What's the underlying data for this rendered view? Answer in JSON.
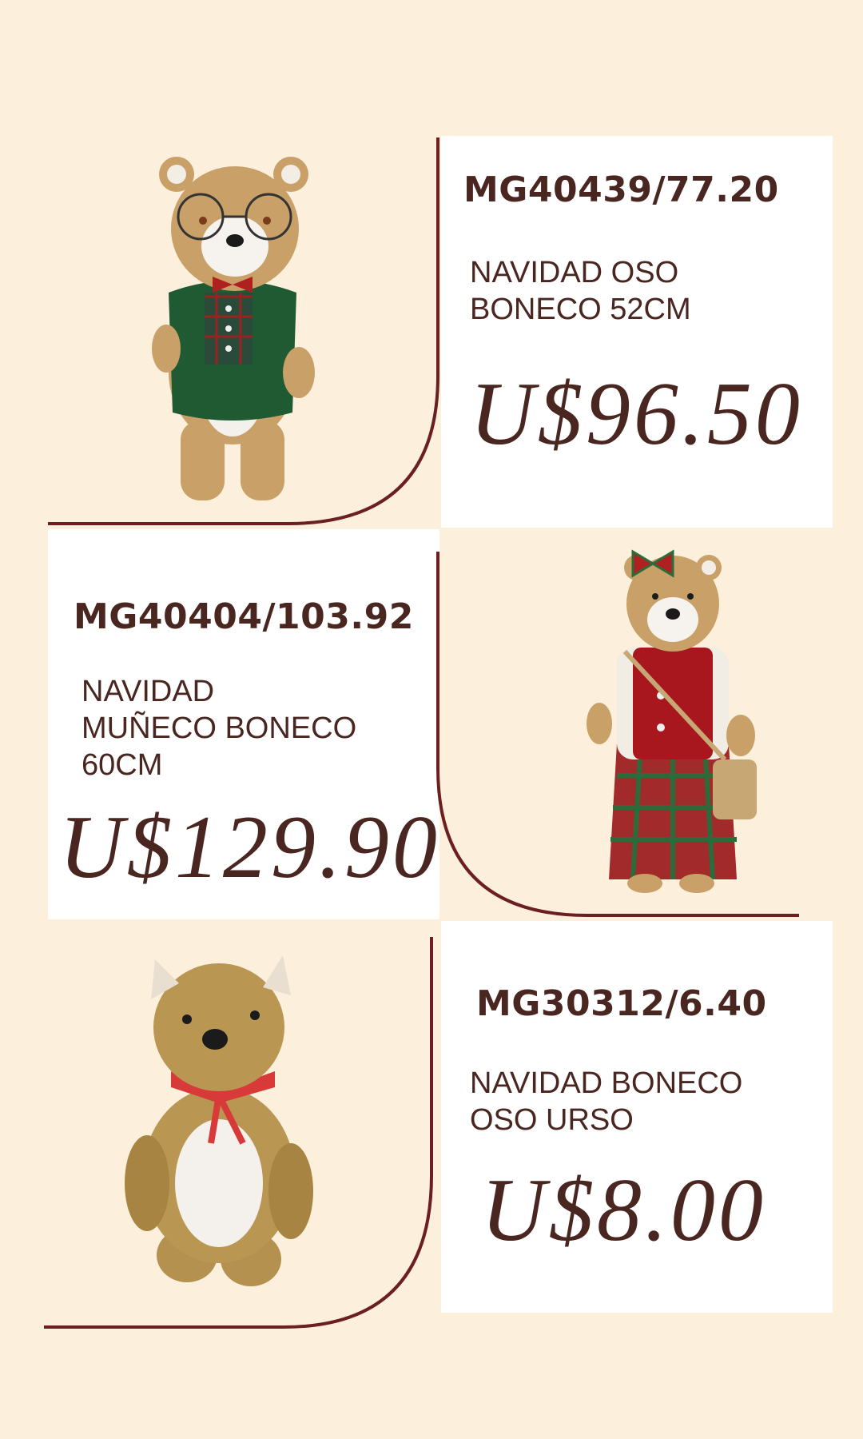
{
  "products": [
    {
      "code": "MG40439/77.20",
      "description": "NAVIDAD OSO\nBONECO 52CM",
      "price": "U$96.50",
      "image": "bear-with-glasses-green-sweater"
    },
    {
      "code": "MG40404/103.92",
      "description": "NAVIDAD\nMUÑECO BONECO\n60CM",
      "price": "U$129.90",
      "image": "bear-girl-red-vest-plaid-skirt"
    },
    {
      "code": "MG30312/6.40",
      "description": "NAVIDAD BONECO\nOSO URSO",
      "price": "U$8.00",
      "image": "straw-bear-red-ribbon"
    }
  ],
  "colors": {
    "background": "#fcf0dd",
    "card": "#ffffff",
    "text": "#4a2620",
    "line": "#6b1f1f"
  }
}
